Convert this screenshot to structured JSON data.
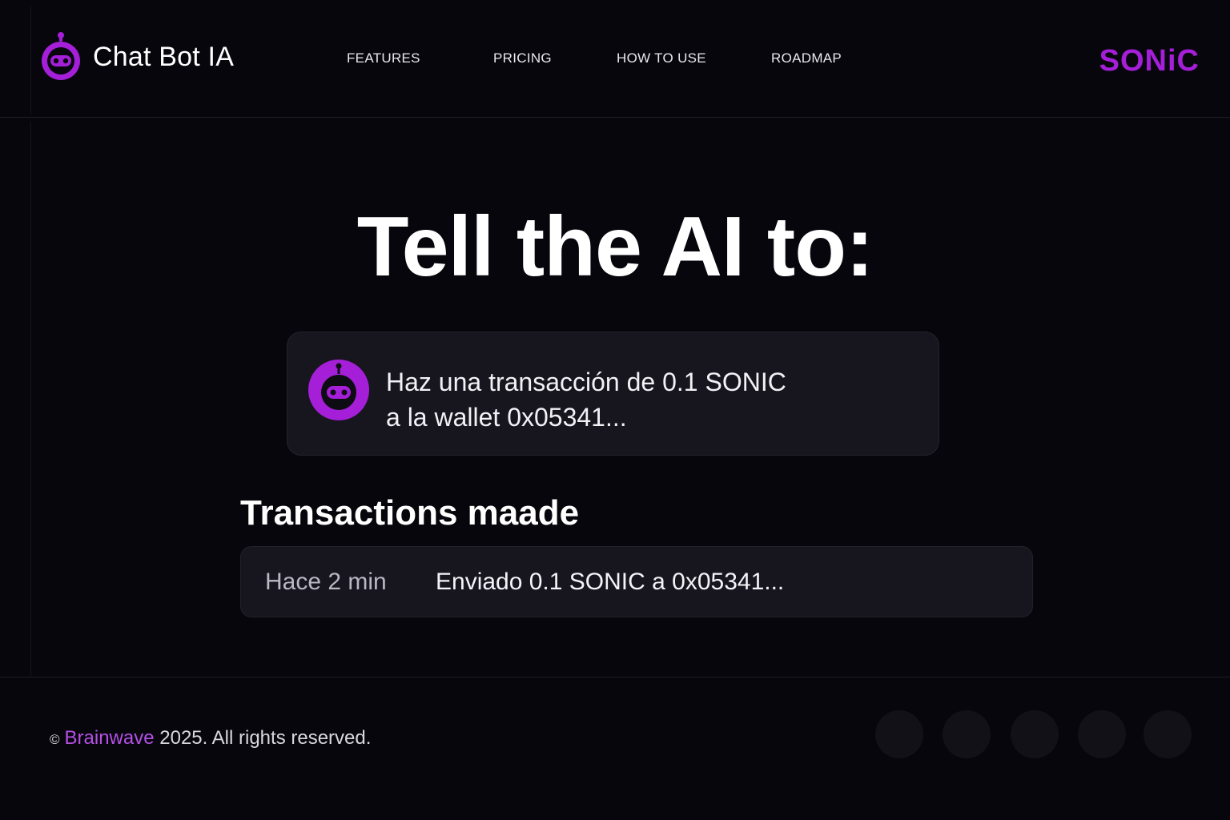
{
  "header": {
    "brand_name": "Chat Bot IA",
    "brand_icon": "robot-icon",
    "nav": [
      "FEATURES",
      "PRICING",
      "HOW TO USE",
      "ROADMAP"
    ],
    "partner_logo_text": "SONiC"
  },
  "hero": {
    "title": "Tell the AI to:",
    "prompt": {
      "line1": "Haz una transacción de 0.1 SONIC",
      "line2": "a la wallet 0x05341..."
    }
  },
  "transactions": {
    "title": "Transactions maade",
    "items": [
      {
        "time": "Hace 2 min",
        "description": "Enviado 0.1 SONIC a 0x05341..."
      }
    ]
  },
  "footer": {
    "copyright_symbol": "©",
    "brand": "Brainwave",
    "rest": " 2025. All rights reserved."
  },
  "colors": {
    "background": "#07060d",
    "accent": "#a51fd9",
    "card": "#17161e"
  }
}
